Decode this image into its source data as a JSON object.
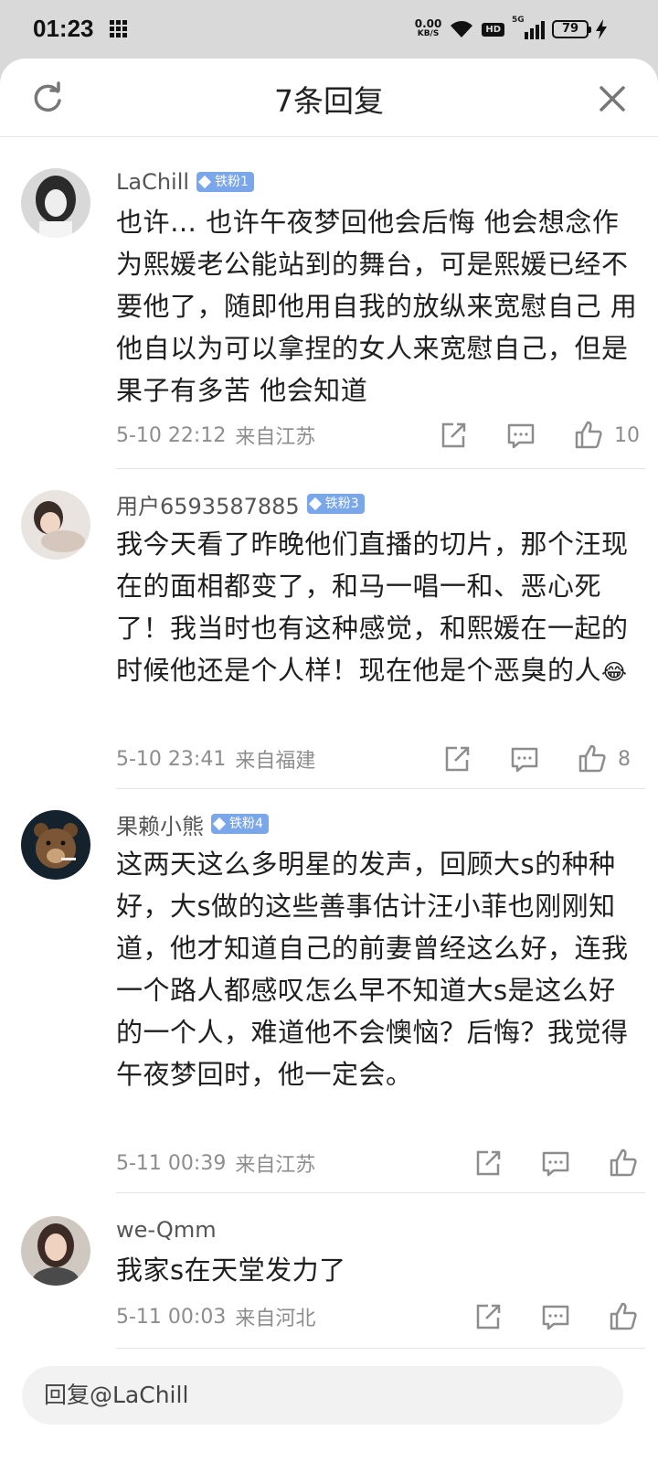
{
  "status_bar": {
    "time": "01:23",
    "net_speed": "0.00",
    "net_unit": "KB/S",
    "hd": "HD",
    "signal": "5G",
    "battery": "79"
  },
  "header": {
    "title": "7条回复"
  },
  "comments": [
    {
      "username": "LaChill",
      "badge": "铁粉1",
      "text": "也许… 也许午夜梦回他会后悔 他会想念作为熙媛老公能站到的舞台，可是熙媛已经不要他了，随即他用自我的放纵来宽慰自己 用他自以为可以拿捏的女人来宽慰自己，但是果子有多苦 他会知道",
      "time": "5-10 22:12",
      "location": "来自江苏",
      "likes": "10"
    },
    {
      "username": "用户6593587885",
      "badge": "铁粉3",
      "text": "我今天看了昨晚他们直播的切片，那个汪现在的面相都变了，和马一唱一和、恶心死了！我当时也有这种感觉，和熙媛在一起的时候他还是个人样！现在他是个恶臭的人",
      "emoji": "😂",
      "time": "5-10 23:41",
      "location": "来自福建",
      "likes": "8"
    },
    {
      "username": "果赖小熊",
      "badge": "铁粉4",
      "text": "这两天这么多明星的发声，回顾大s的种种好，大s做的这些善事估计汪小菲也刚刚知道，他才知道自己的前妻曾经这么好，连我一个路人都感叹怎么早不知道大s是这么好的一个人，难道他不会懊恼？后悔？我觉得午夜梦回时，他一定会。",
      "time": "5-11 00:39",
      "location": "来自江苏",
      "likes": ""
    },
    {
      "username": "we-Qmm",
      "badge": "",
      "text": "我家s在天堂发力了",
      "time": "5-11 00:03",
      "location": "来自河北",
      "likes": ""
    }
  ],
  "reply_bar": {
    "placeholder": "回复@LaChill"
  },
  "colors": {
    "badge": "#7aa7ea",
    "meta_text": "#8d8d8d",
    "divider": "#e3e3e3"
  }
}
